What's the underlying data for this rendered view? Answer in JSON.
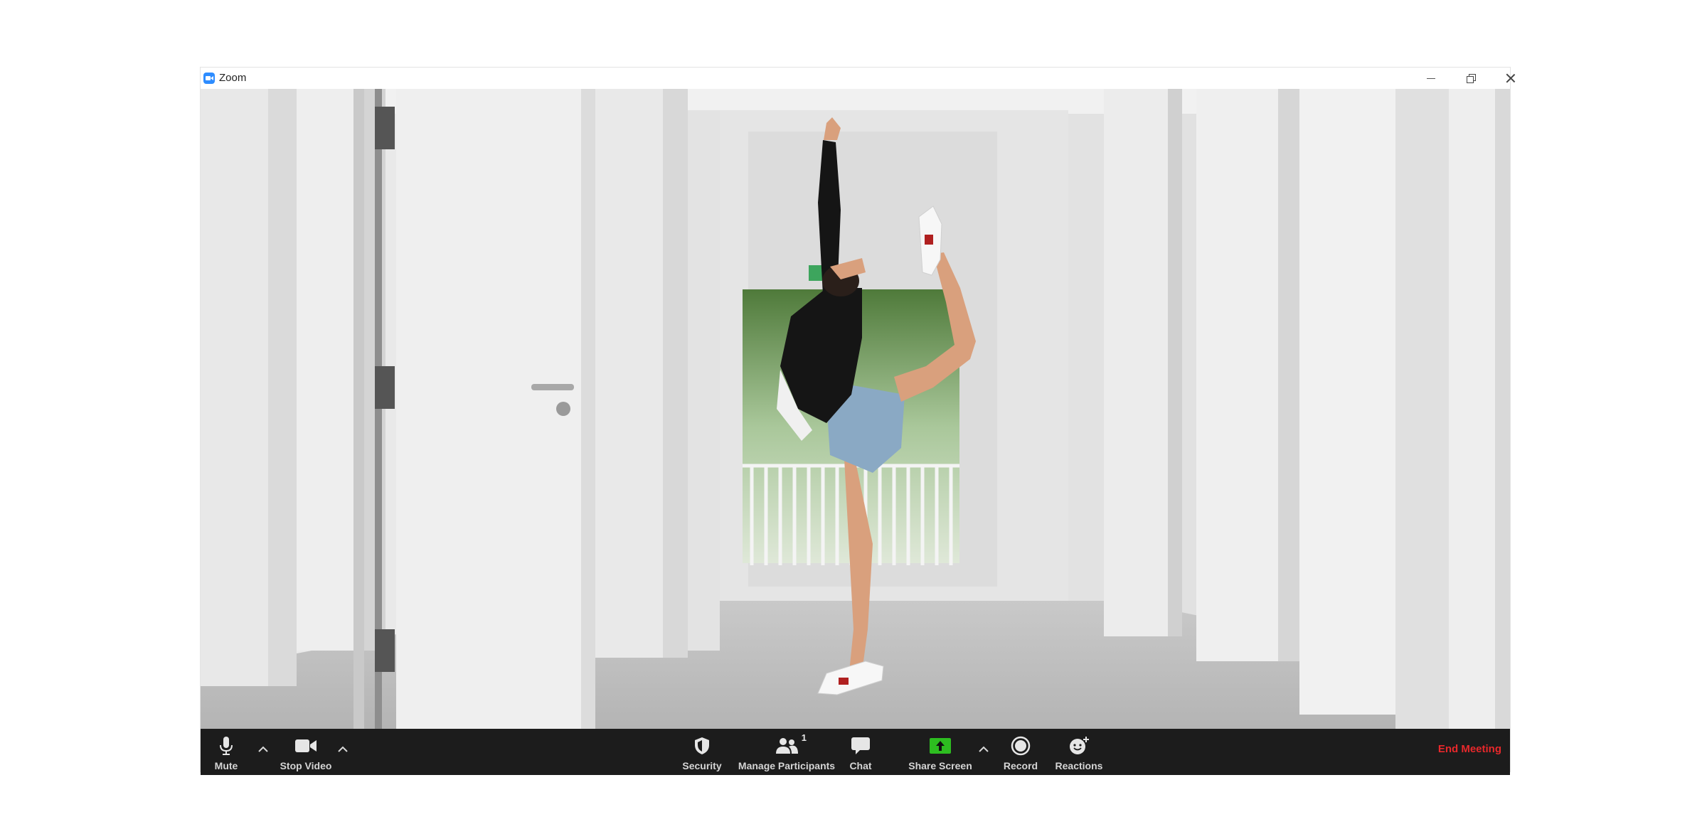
{
  "window": {
    "title": "Zoom",
    "controls": {
      "minimize": "minimize",
      "maximize": "restore",
      "close": "close"
    }
  },
  "toolbar": {
    "mute_label": "Mute",
    "stop_video_label": "Stop Video",
    "security_label": "Security",
    "participants_label": "Manage Participants",
    "participants_count": "1",
    "chat_label": "Chat",
    "share_screen_label": "Share Screen",
    "record_label": "Record",
    "reactions_label": "Reactions",
    "end_meeting_label": "End Meeting"
  },
  "icons": {
    "mute": "microphone-icon",
    "stop_video": "video-camera-icon",
    "security": "shield-icon",
    "participants": "participants-icon",
    "chat": "chat-bubble-icon",
    "share_screen": "share-screen-icon",
    "record": "record-icon",
    "reactions": "emoji-icon"
  },
  "colors": {
    "toolbar_bg": "#1c1c1c",
    "share_green": "#2dbd20",
    "end_meeting_red": "#e8282b",
    "zoom_blue": "#2d8cff"
  }
}
